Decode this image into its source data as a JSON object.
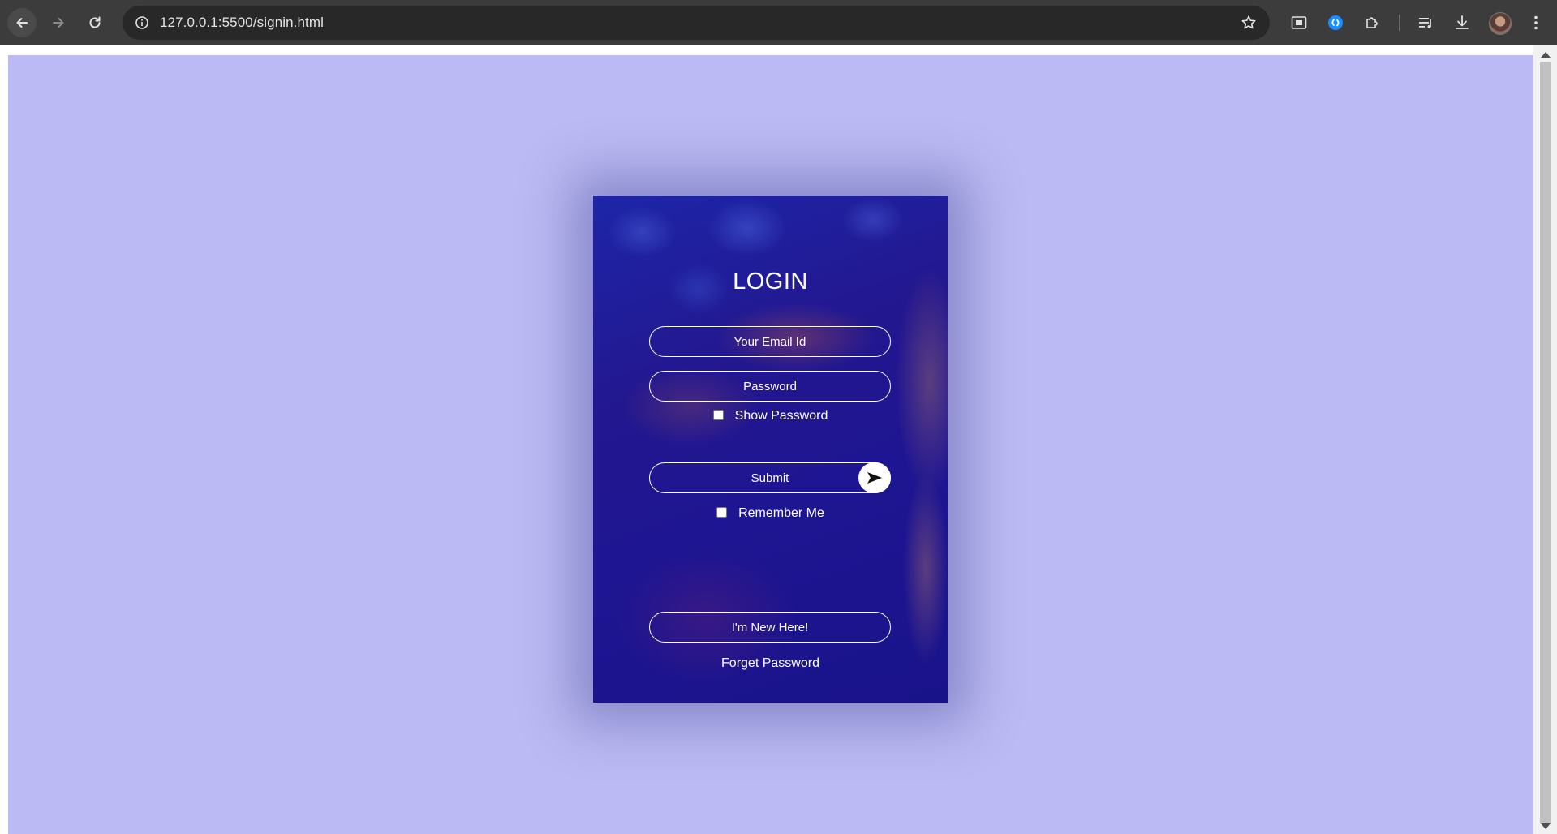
{
  "browser": {
    "url": "127.0.0.1:5500/signin.html",
    "icons": [
      "back-arrow-icon",
      "forward-arrow-icon",
      "reload-icon",
      "site-info-icon",
      "bookmark-star-icon",
      "picture-in-picture-icon",
      "shazam-extension-icon",
      "extensions-puzzle-icon",
      "media-queue-icon",
      "download-icon",
      "profile-avatar",
      "kebab-menu-icon"
    ]
  },
  "page": {
    "background": "#bbbaf4"
  },
  "login": {
    "title": "LOGIN",
    "email_placeholder": "Your Email Id",
    "password_placeholder": "Password",
    "show_password_label": "Show Password",
    "submit_label": "Submit",
    "remember_label": "Remember Me",
    "new_here_label": "I'm New Here!",
    "forget_label": "Forget Password"
  }
}
